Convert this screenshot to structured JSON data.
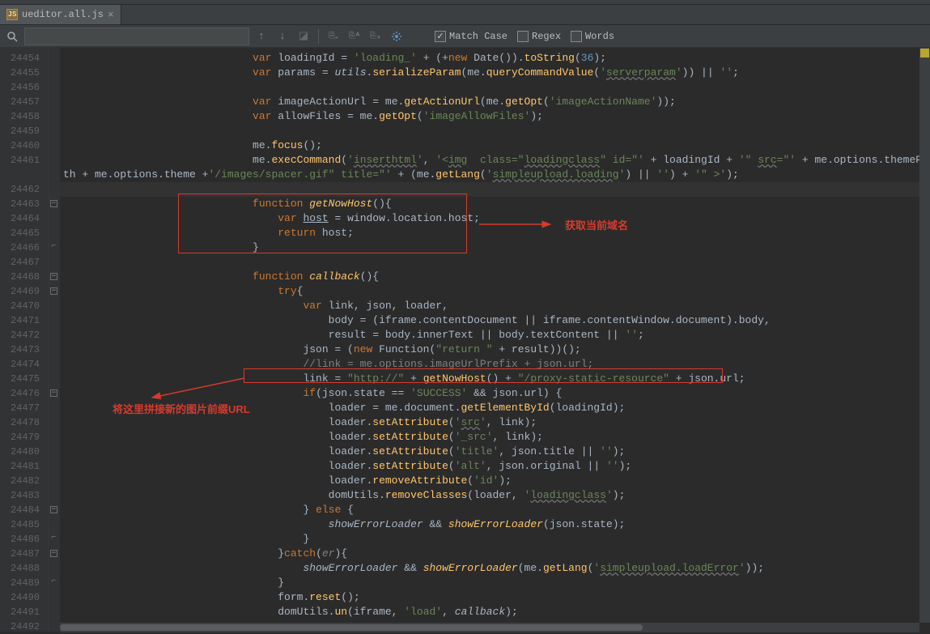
{
  "tab": {
    "filename": "ueditor.all.js"
  },
  "find": {
    "case_label": "Match Case",
    "regex_label": "Regex",
    "words_label": "Words",
    "case_checked": true,
    "regex_checked": false,
    "words_checked": false,
    "value": ""
  },
  "gutter": {
    "start": 24454,
    "end": 24492
  },
  "annotations": {
    "right_label": "获取当前域名",
    "left_label": "将这里拼接新的图片前缀URL"
  },
  "code": {
    "lines": [
      {
        "n": 24454,
        "html": "                              <span class='kw'>var </span>loadingId = <span class='str'>'loading_'</span> + (+<span class='kw'>new </span>Date()).<span class='fn'>toString</span>(<span class='num'>36</span>);"
      },
      {
        "n": 24455,
        "html": "                              <span class='kw'>var </span>params = <span class='param'>utils</span>.<span class='fn'>serializeParam</span>(me.<span class='fn'>queryCommandValue</span>(<span class='str'>'<span class='wavy'>serverparam</span>'</span>)) || <span class='str'>''</span>;"
      },
      {
        "n": 24456,
        "html": ""
      },
      {
        "n": 24457,
        "html": "                              <span class='kw'>var </span>imageActionUrl = me.<span class='fn'>getActionUrl</span>(me.<span class='fn'>getOpt</span>(<span class='str'>'imageActionName'</span>));"
      },
      {
        "n": 24458,
        "html": "                              <span class='kw'>var </span>allowFiles = me.<span class='fn'>getOpt</span>(<span class='str'>'imageAllowFiles'</span>);"
      },
      {
        "n": 24459,
        "html": ""
      },
      {
        "n": 24460,
        "html": "                              me.<span class='fn'>focus</span>();"
      },
      {
        "n": 24461,
        "html": "                              me.<span class='fn'>execCommand</span>(<span class='str'>'<span class='wavy'>inserthtml</span>'</span>, <span class='str'>'&lt;<span class='wavy'>img</span>  class=&quot;<span class='wavy'>loadingclass</span>&quot; id=&quot;'</span> + loadingId + <span class='str'>'&quot; <span class='wavy'>src</span>=&quot;'</span> + me.options.themePath + me.options.theme +<span class='str'>'/images/spacer.gif&quot; title=&quot;'</span> + (me.<span class='fn'>getLang</span>(<span class='str'>'<span class='wavy'>simpleupload.loading</span>'</span>) || <span class='str'>''</span>) + <span class='str'>'&quot; &gt;'</span>);"
      },
      {
        "n": 24462,
        "html": "",
        "caret": true
      },
      {
        "n": 24463,
        "html": "                              <span class='kw'>function </span><span class='sfn'>getNowHost</span>(){",
        "fold": "-"
      },
      {
        "n": 24464,
        "html": "                                  <span class='kw'>var </span><span class='ul'>host</span> = window.location.host;"
      },
      {
        "n": 24465,
        "html": "                                  <span class='kw'>return </span>host;"
      },
      {
        "n": 24466,
        "html": "                              }",
        "fold": "end"
      },
      {
        "n": 24467,
        "html": ""
      },
      {
        "n": 24468,
        "html": "                              <span class='kw'>function </span><span class='sfn'>callback</span>(){",
        "fold": "-"
      },
      {
        "n": 24469,
        "html": "                                  <span class='kw'>try</span>{",
        "fold": "-"
      },
      {
        "n": 24470,
        "html": "                                      <span class='kw'>var </span>link, json, loader,"
      },
      {
        "n": 24471,
        "html": "                                          body = (iframe.contentDocument || iframe.contentWindow.document).body,"
      },
      {
        "n": 24472,
        "html": "                                          result = body.innerText || body.textContent || <span class='str'>''</span>;"
      },
      {
        "n": 24473,
        "html": "                                      json = (<span class='kw'>new </span>Function(<span class='str'>&quot;return &quot;</span> + result))();"
      },
      {
        "n": 24474,
        "html": "                                      <span class='comment'>//link = me.options.imageUrlPrefix + json.url;</span>"
      },
      {
        "n": 24475,
        "html": "                                      link = <span class='str'>&quot;http://&quot;</span> + <span class='fn'>getNowHost</span>() + <span class='str'>&quot;/proxy-static-resource&quot;</span> + json.url;"
      },
      {
        "n": 24476,
        "html": "                                      <span class='kw'>if</span>(json.state == <span class='str'>'SUCCESS'</span> &amp;&amp; json.url) {",
        "fold": "-"
      },
      {
        "n": 24477,
        "html": "                                          loader = me.document.<span class='fn'>getElementById</span>(loadingId);"
      },
      {
        "n": 24478,
        "html": "                                          loader.<span class='fn'>setAttribute</span>(<span class='str'>'<span class='wavy'>src</span>'</span>, link);"
      },
      {
        "n": 24479,
        "html": "                                          loader.<span class='fn'>setAttribute</span>(<span class='str'>'_src'</span>, link);"
      },
      {
        "n": 24480,
        "html": "                                          loader.<span class='fn'>setAttribute</span>(<span class='str'>'title'</span>, json.title || <span class='str'>''</span>);"
      },
      {
        "n": 24481,
        "html": "                                          loader.<span class='fn'>setAttribute</span>(<span class='str'>'alt'</span>, json.original || <span class='str'>''</span>);"
      },
      {
        "n": 24482,
        "html": "                                          loader.<span class='fn'>removeAttribute</span>(<span class='str'>'id'</span>);"
      },
      {
        "n": 24483,
        "html": "                                          domUtils.<span class='fn'>removeClasses</span>(loader, <span class='str'>'<span class='wavy'>loadingclass</span>'</span>);"
      },
      {
        "n": 24484,
        "html": "                                      } <span class='kw'>else </span>{",
        "fold": "-"
      },
      {
        "n": 24485,
        "html": "                                          <span class='param'>showErrorLoader</span> &amp;&amp; <span class='sfn'>showErrorLoader</span>(json.state);"
      },
      {
        "n": 24486,
        "html": "                                      }",
        "fold": "end"
      },
      {
        "n": 24487,
        "html": "                                  }<span class='kw'>catch</span>(<span class='unused'>er</span>){",
        "fold": "-"
      },
      {
        "n": 24488,
        "html": "                                      <span class='param'>showErrorLoader</span> &amp;&amp; <span class='sfn'>showErrorLoader</span>(me.<span class='fn'>getLang</span>(<span class='str'>'<span class='wavy'>simpleupload.loadError</span>'</span>));"
      },
      {
        "n": 24489,
        "html": "                                  }",
        "fold": "end"
      },
      {
        "n": 24490,
        "html": "                                  form.<span class='fn'>reset</span>();"
      },
      {
        "n": 24491,
        "html": "                                  domUtils.<span class='fn'>un</span>(iframe, <span class='str'>'load'</span>, <span class='param'>callback</span>);"
      },
      {
        "n": 24492,
        "html": ""
      }
    ]
  }
}
